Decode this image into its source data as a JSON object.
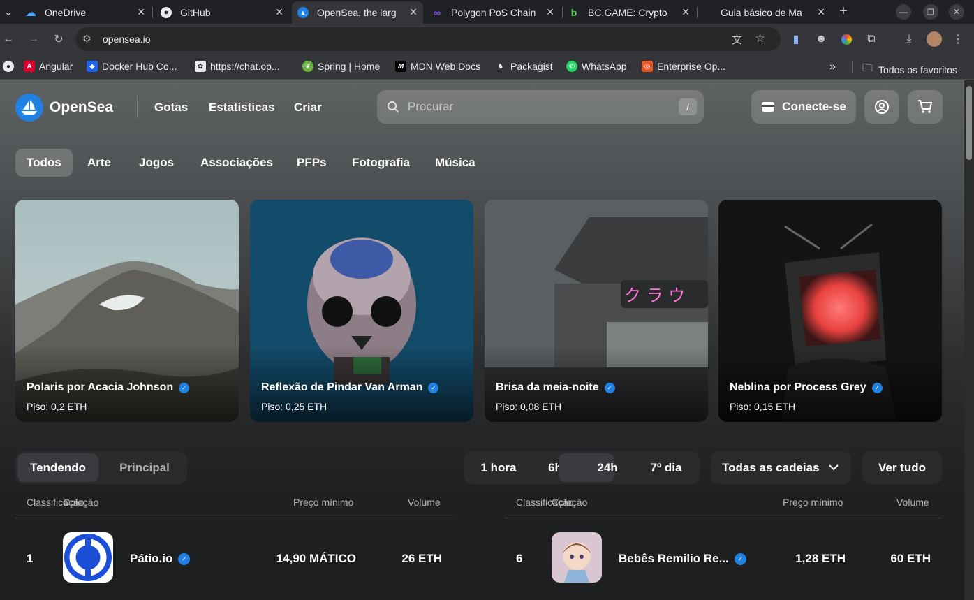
{
  "browser": {
    "tabs": [
      {
        "title": "OneDrive",
        "icon": "onedrive-icon",
        "active": false
      },
      {
        "title": "GitHub",
        "icon": "github-icon",
        "active": false
      },
      {
        "title": "OpenSea, the larg",
        "icon": "opensea-icon",
        "active": true
      },
      {
        "title": "Polygon PoS Chain",
        "icon": "polygon-icon",
        "active": false
      },
      {
        "title": "BC.GAME: Crypto",
        "icon": "bcgame-icon",
        "active": false
      },
      {
        "title": "Guia básico de Ma",
        "icon": "page-icon",
        "active": false
      }
    ],
    "url": "opensea.io",
    "bookmarks": [
      {
        "label": "Angular",
        "icon": "angular-icon"
      },
      {
        "label": "Docker Hub Co...",
        "icon": "docker-icon"
      },
      {
        "label": "https://chat.op...",
        "icon": "openai-icon"
      },
      {
        "label": "Spring | Home",
        "icon": "spring-icon"
      },
      {
        "label": "MDN Web Docs",
        "icon": "mdn-icon"
      },
      {
        "label": "Packagist",
        "icon": "packagist-icon"
      },
      {
        "label": "WhatsApp",
        "icon": "whatsapp-icon"
      },
      {
        "label": "Enterprise Op...",
        "icon": "ubuntu-icon"
      }
    ],
    "all_bookmarks": "Todos os favoritos",
    "overflow": "»"
  },
  "header": {
    "logo_text": "OpenSea",
    "nav": [
      "Gotas",
      "Estatísticas",
      "Criar"
    ],
    "search_placeholder": "Procurar",
    "search_shortcut": "/",
    "connect_label": "Conecte-se"
  },
  "categories": [
    {
      "label": "Todos",
      "selected": true
    },
    {
      "label": "Arte",
      "selected": false
    },
    {
      "label": "Jogos",
      "selected": false
    },
    {
      "label": "Associações",
      "selected": false
    },
    {
      "label": "PFPs",
      "selected": false
    },
    {
      "label": "Fotografia",
      "selected": false
    },
    {
      "label": "Música",
      "selected": false
    }
  ],
  "featured": [
    {
      "title": "Polaris por Acacia Johnson",
      "floor": "Piso: 0,2 ETH"
    },
    {
      "title": "Reflexão de Pindar Van Arman",
      "floor": "Piso: 0,25 ETH"
    },
    {
      "title": "Brisa da meia-noite",
      "floor": "Piso: 0,08 ETH"
    },
    {
      "title": "Neblina por Process Grey",
      "floor": "Piso: 0,15 ETH"
    }
  ],
  "stats": {
    "toggle": [
      "Tendendo",
      "Principal"
    ],
    "toggle_selected": "Tendendo",
    "time_ranges": [
      "1 hora",
      "6h",
      "24h",
      "7º dia"
    ],
    "time_selected": "24h",
    "chain_filter": "Todas as cadeias",
    "see_all": "Ver tudo",
    "columns": {
      "rank": "Classificação",
      "collection": "Coleção",
      "floor": "Preço mínimo",
      "volume": "Volume"
    },
    "rows": [
      {
        "rank": "1",
        "name": "Pátio.io",
        "floor": "14,90 MÁTICO",
        "volume": "26 ETH"
      },
      {
        "rank": "6",
        "name": "Bebês Remilio Re...",
        "floor": "1,28 ETH",
        "volume": "60 ETH"
      }
    ]
  }
}
